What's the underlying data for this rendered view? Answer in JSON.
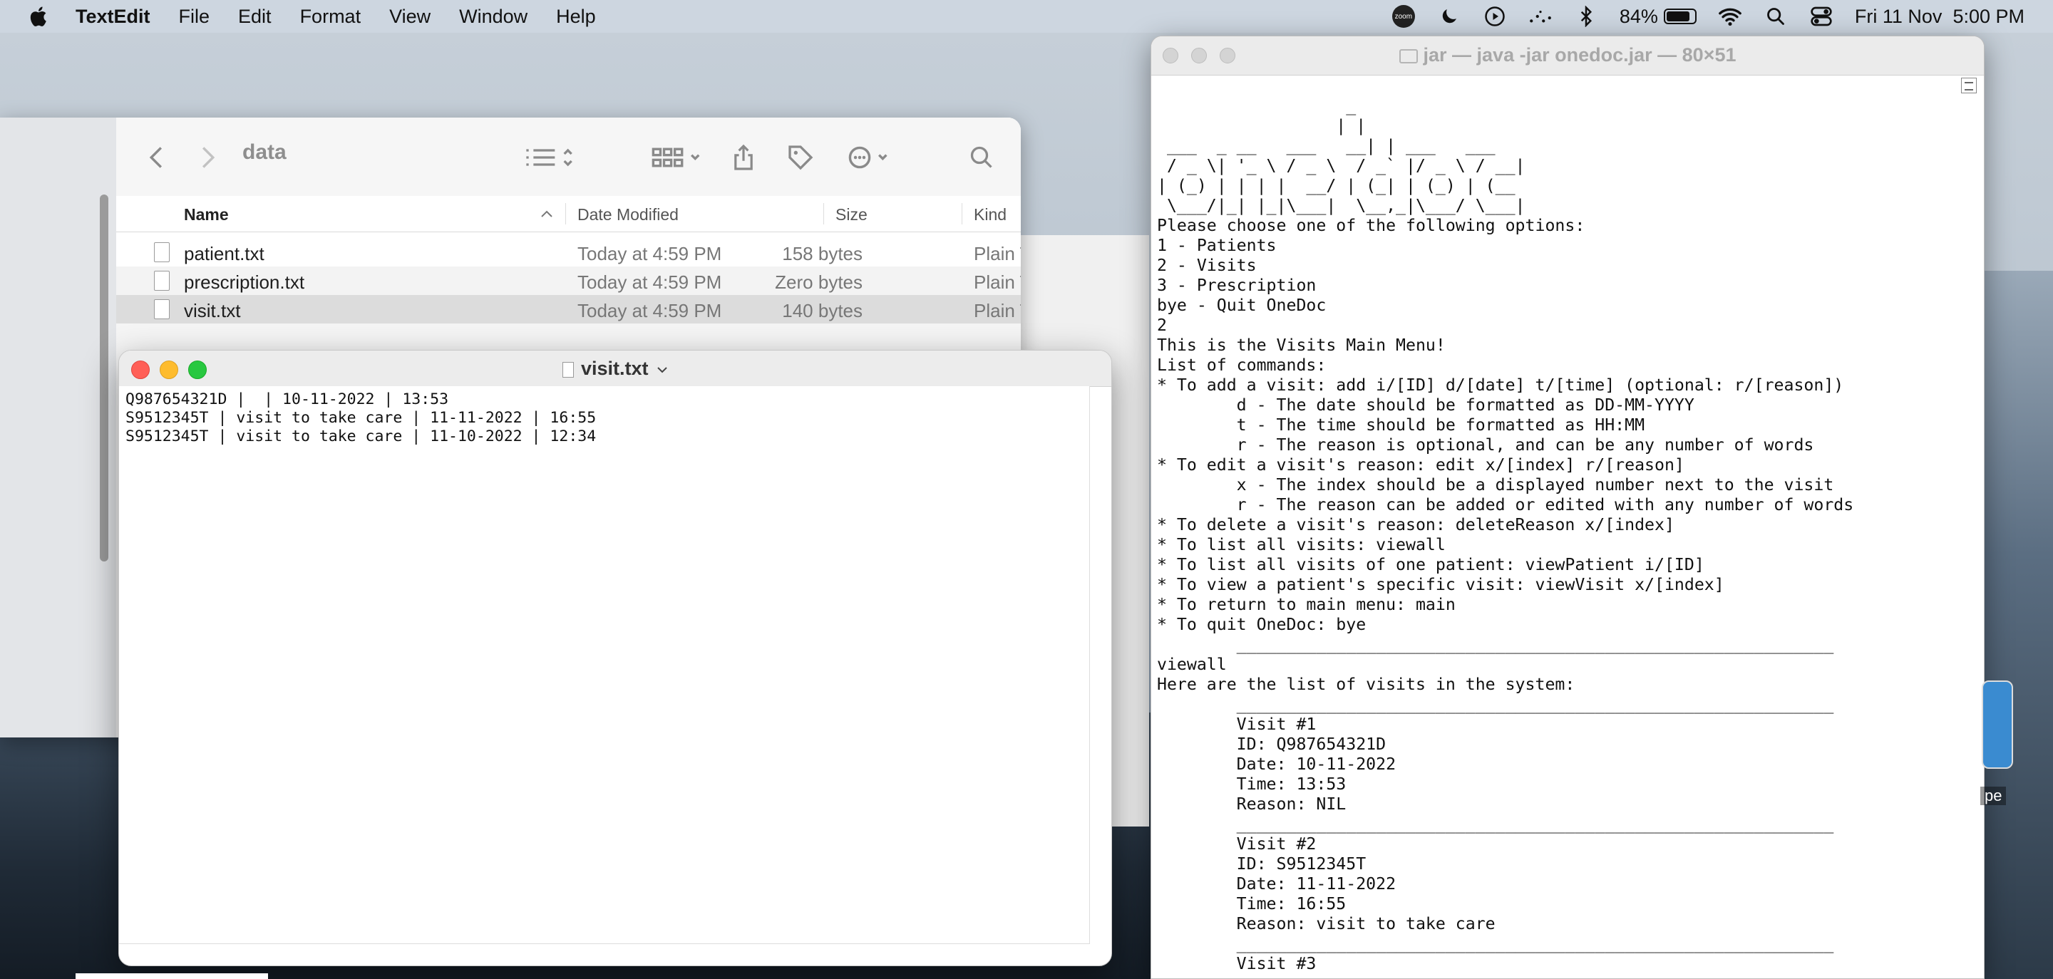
{
  "menubar": {
    "app": "TextEdit",
    "items": [
      "File",
      "Edit",
      "Format",
      "View",
      "Window",
      "Help"
    ],
    "battery": "84%",
    "battery_level": 0.84,
    "datetime": "Fri 11 Nov  5:00 PM",
    "zoom_label": "zoom",
    "icons": [
      "zoom-icon",
      "moon-icon",
      "play-circle-icon",
      "dots-icon",
      "bluetooth-icon",
      "battery-icon",
      "wifi-icon",
      "search-icon",
      "control-center-icon"
    ]
  },
  "finder": {
    "title": "data",
    "columns": {
      "name": "Name",
      "date": "Date Modified",
      "size": "Size",
      "kind": "Kind"
    },
    "files": [
      {
        "name": "patient.txt",
        "date": "Today at 4:59 PM",
        "size": "158 bytes",
        "kind": "Plain T"
      },
      {
        "name": "prescription.txt",
        "date": "Today at 4:59 PM",
        "size": "Zero bytes",
        "kind": "Plain T"
      },
      {
        "name": "visit.txt",
        "date": "Today at 4:59 PM",
        "size": "140 bytes",
        "kind": "Plain T"
      }
    ]
  },
  "textedit": {
    "title": "visit.txt",
    "content": "Q987654321D |  | 10-11-2022 | 13:53\nS9512345T | visit to take care | 11-11-2022 | 16:55\nS9512345T | visit to take care | 11-10-2022 | 12:34"
  },
  "terminal": {
    "title": "jar — java -jar onedoc.jar — 80×51",
    "output": "                   _\n                  | |\n ___  _ __   ___   __| | ___   ___\n / _ \\| '_ \\ / _ \\  / _` |/ _ \\ / __|\n| (_) | | | |  __/ | (_| | (_) | (__\n \\___/|_| |_|\\___|  \\__,_|\\___/ \\___|\nPlease choose one of the following options:\n1 - Patients\n2 - Visits\n3 - Prescription\nbye - Quit OneDoc\n2\nThis is the Visits Main Menu!\nList of commands:\n* To add a visit: add i/[ID] d/[date] t/[time] (optional: r/[reason])\n        d - The date should be formatted as DD-MM-YYYY\n        t - The time should be formatted as HH:MM\n        r - The reason is optional, and can be any number of words\n* To edit a visit's reason: edit x/[index] r/[reason]\n        x - The index should be a displayed number next to the visit\n        r - The reason can be added or edited with any number of words\n* To delete a visit's reason: deleteReason x/[index]\n* To list all visits: viewall\n* To list all visits of one patient: viewPatient i/[ID]\n* To view a patient's specific visit: viewVisit x/[index]\n* To return to main menu: main\n* To quit OneDoc: bye\n        ____________________________________________________________\nviewall\nHere are the list of visits in the system:\n        ____________________________________________________________\n        Visit #1\n        ID: Q987654321D\n        Date: 10-11-2022\n        Time: 13:53\n        Reason: NIL\n        ____________________________________________________________\n        Visit #2\n        ID: S9512345T\n        Date: 11-11-2022\n        Time: 16:55\n        Reason: visit to take care\n        ____________________________________________________________\n        Visit #3"
  },
  "desktop": {
    "peek_label": "pe"
  }
}
